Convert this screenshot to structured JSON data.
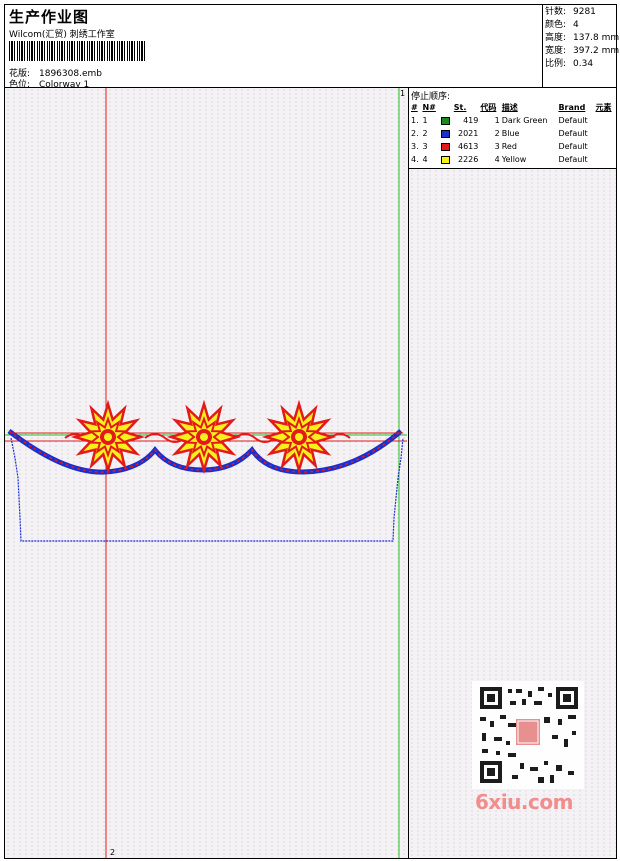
{
  "header": {
    "title": "生产作业图",
    "company": "Wilcom(汇贸) 刺绣工作室",
    "design_label": "花版:",
    "design_value": "1896308.emb",
    "colorway_label": "色位:",
    "colorway_value": "Colorway 1"
  },
  "stats": [
    {
      "label": "针数:",
      "value": "9281"
    },
    {
      "label": "颜色:",
      "value": "4"
    },
    {
      "label": "高度:",
      "value": "137.8 mm"
    },
    {
      "label": "宽度:",
      "value": "397.2 mm"
    },
    {
      "label": "比例:",
      "value": "0.34"
    }
  ],
  "stop_sequence": {
    "title": "停止顺序:",
    "columns": [
      "#",
      "N#",
      "St.",
      "代码",
      "描述",
      "Brand",
      "元素"
    ],
    "rows": [
      {
        "idx": "1.",
        "n": "1",
        "st": "419",
        "code": "1",
        "desc": "Dark Green",
        "brand": "Default",
        "color": "#1a8a1a"
      },
      {
        "idx": "2.",
        "n": "2",
        "st": "2021",
        "code": "2",
        "desc": "Blue",
        "brand": "Default",
        "color": "#1a2fd0"
      },
      {
        "idx": "3.",
        "n": "3",
        "st": "4613",
        "code": "3",
        "desc": "Red",
        "brand": "Default",
        "color": "#e41a1a"
      },
      {
        "idx": "4.",
        "n": "4",
        "st": "2226",
        "code": "4",
        "desc": "Yellow",
        "brand": "Default",
        "color": "#f7f01a"
      }
    ]
  },
  "canvas": {
    "marker_top": "1",
    "marker_bottom": "2"
  },
  "colors": {
    "green": "#22c422",
    "blue": "#1a2fd0",
    "red": "#e41a1a",
    "yellow": "#f7f01a"
  },
  "watermark": "6xiu.com"
}
